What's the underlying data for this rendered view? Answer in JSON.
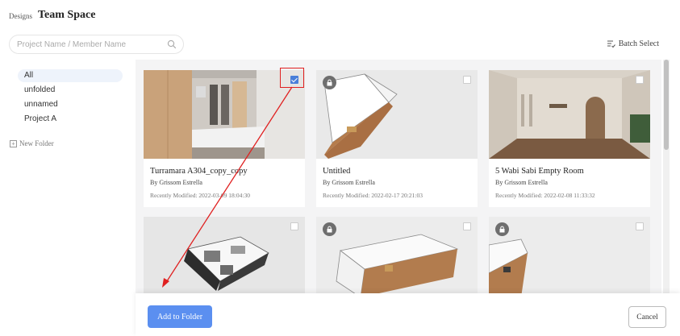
{
  "header": {
    "breadcrumb": "Designs",
    "title": "Team Space"
  },
  "search": {
    "placeholder": "Project Name / Member Name",
    "value": ""
  },
  "batch_select": {
    "label": "Batch Select"
  },
  "sidebar": {
    "items": [
      {
        "label": "All",
        "active": true
      },
      {
        "label": "unfolded",
        "active": false
      },
      {
        "label": "unnamed",
        "active": false
      },
      {
        "label": "Project A",
        "active": false
      }
    ],
    "new_folder": "New Folder"
  },
  "cards": [
    {
      "title": "Turramara A304_copy_copy",
      "owner": "By Grissom Estrella",
      "modified": "Recently Modified: 2022-03-09 18:04:30",
      "checked": true,
      "locked": false
    },
    {
      "title": "Untitled",
      "owner": "By Grissom Estrella",
      "modified": "Recently Modified: 2022-02-17 20:21:03",
      "checked": false,
      "locked": true
    },
    {
      "title": "5 Wabi Sabi Empty Room",
      "owner": "By Grissom Estrella",
      "modified": "Recently Modified: 2022-02-08 11:33:32",
      "checked": false,
      "locked": false
    },
    {
      "checked": false,
      "locked": false
    },
    {
      "checked": false,
      "locked": true
    },
    {
      "checked": false,
      "locked": true
    }
  ],
  "footer": {
    "add_label": "Add to Folder",
    "cancel_label": "Cancel"
  },
  "colors": {
    "primary": "#5b8ff0",
    "checkbox_checked": "#4a7fd9",
    "annotation": "#e02020",
    "sidebar_active": "#eef3fb"
  }
}
